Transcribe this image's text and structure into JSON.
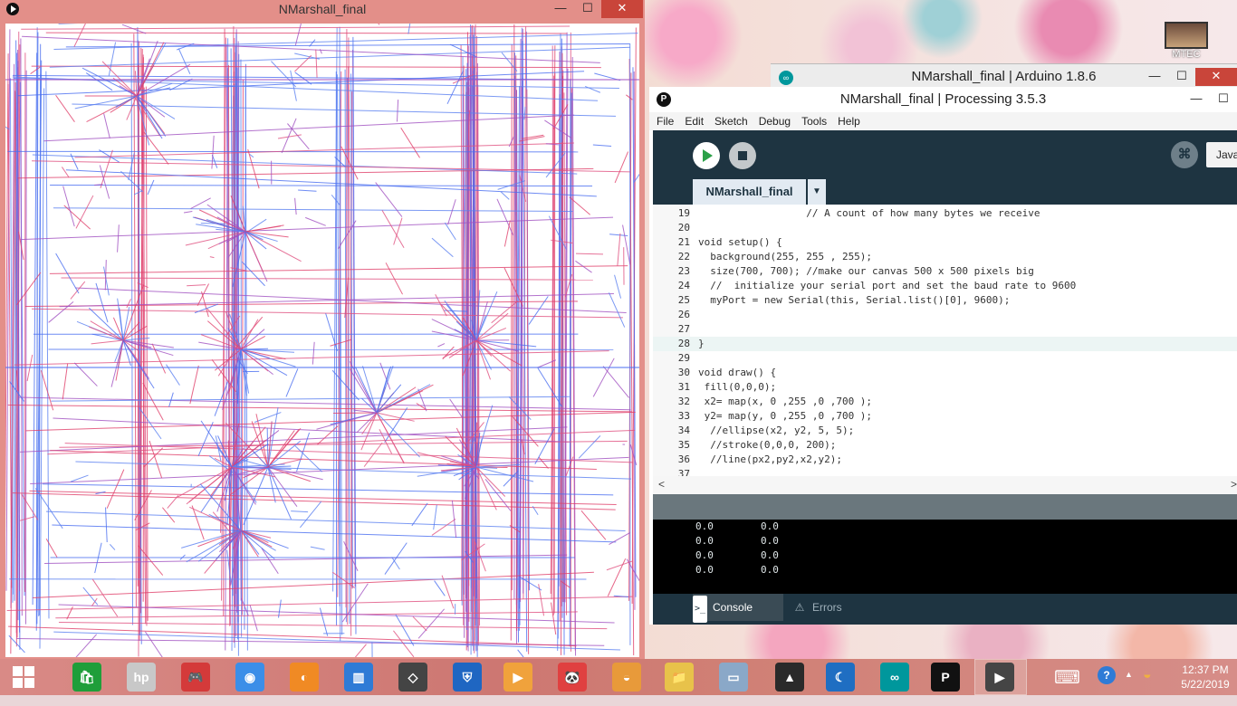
{
  "sketch_window": {
    "title": "NMarshall_final",
    "minimize": "—",
    "maximize": "☐",
    "close": "✕"
  },
  "arduino_window": {
    "title": "NMarshall_final | Arduino 1.8.6",
    "icon_text": "∞",
    "minimize": "—",
    "maximize": "☐",
    "close": "✕"
  },
  "desktop": {
    "shortcut_label": "MTEC"
  },
  "ide": {
    "title": "NMarshall_final | Processing 3.5.3",
    "icon_text": "P",
    "minimize": "—",
    "maximize": "☐",
    "menu": [
      "File",
      "Edit",
      "Sketch",
      "Debug",
      "Tools",
      "Help"
    ],
    "mode": "Java",
    "debugger_icon_text": "⌘",
    "tab_name": "NMarshall_final",
    "tab_menu": "▼",
    "code_lines": [
      {
        "n": "19",
        "text": "                  // A count of how many bytes we receive"
      },
      {
        "n": "20",
        "text": ""
      },
      {
        "n": "21",
        "text": "void setup() {"
      },
      {
        "n": "22",
        "text": "  background(255, 255 , 255);"
      },
      {
        "n": "23",
        "text": "  size(700, 700); //make our canvas 500 x 500 pixels big"
      },
      {
        "n": "24",
        "text": "  //  initialize your serial port and set the baud rate to 9600"
      },
      {
        "n": "25",
        "text": "  myPort = new Serial(this, Serial.list()[0], 9600);"
      },
      {
        "n": "26",
        "text": ""
      },
      {
        "n": "27",
        "text": ""
      },
      {
        "n": "28",
        "text": "}"
      },
      {
        "n": "29",
        "text": ""
      },
      {
        "n": "30",
        "text": "void draw() {"
      },
      {
        "n": "31",
        "text": " fill(0,0,0);"
      },
      {
        "n": "32",
        "text": " x2= map(x, 0 ,255 ,0 ,700 );"
      },
      {
        "n": "33",
        "text": " y2= map(y, 0 ,255 ,0 ,700 );"
      },
      {
        "n": "34",
        "text": "  //ellipse(x2, y2, 5, 5);"
      },
      {
        "n": "35",
        "text": "  //stroke(0,0,0, 200);"
      },
      {
        "n": "36",
        "text": "  //line(px2,py2,x2,y2);"
      },
      {
        "n": "37",
        "text": ""
      }
    ],
    "current_line": "28",
    "scroll_left": "<",
    "scroll_right": ">",
    "console_lines": [
      {
        "a": "0.0",
        "b": "0.0"
      },
      {
        "a": "0.0",
        "b": "0.0"
      },
      {
        "a": "0.0",
        "b": "0.0"
      },
      {
        "a": "0.0",
        "b": "0.0"
      }
    ],
    "console_tab": "Console",
    "errors_tab": "Errors",
    "console_icon": ">_",
    "errors_icon": "⚠"
  },
  "taskbar": {
    "start_icon": "start-windows-icon",
    "apps": [
      {
        "name": "store",
        "glyph": "🛍",
        "color": "#1f9e3a"
      },
      {
        "name": "hp",
        "glyph": "hp",
        "color": "#c8c8c8"
      },
      {
        "name": "games",
        "glyph": "🎮",
        "color": "#d43a3a"
      },
      {
        "name": "chrome",
        "glyph": "◉",
        "color": "#3b8ee8"
      },
      {
        "name": "blender",
        "glyph": "◐",
        "color": "#f08a24"
      },
      {
        "name": "stats",
        "glyph": "▥",
        "color": "#2f7bd6"
      },
      {
        "name": "unity",
        "glyph": "◇",
        "color": "#444444"
      },
      {
        "name": "defender",
        "glyph": "⛨",
        "color": "#1f66c2"
      },
      {
        "name": "media",
        "glyph": "▶",
        "color": "#f0a23c"
      },
      {
        "name": "panda",
        "glyph": "🐼",
        "color": "#e04040"
      },
      {
        "name": "landscape",
        "glyph": "◒",
        "color": "#e89a3a"
      },
      {
        "name": "explorer",
        "glyph": "📁",
        "color": "#e8c24a"
      },
      {
        "name": "monitor",
        "glyph": "▭",
        "color": "#8aa8c8"
      },
      {
        "name": "shark",
        "glyph": "▲",
        "color": "#2a2a2a"
      },
      {
        "name": "moon",
        "glyph": "☾",
        "color": "#1f6ec2"
      },
      {
        "name": "arduino",
        "glyph": "∞",
        "color": "#00979c"
      },
      {
        "name": "processing",
        "glyph": "P",
        "color": "#111111"
      },
      {
        "name": "sketch-run",
        "glyph": "▶",
        "color": "#111111"
      }
    ],
    "tray": {
      "keyboard": "⌨",
      "help": "?",
      "chevron": "▲",
      "network": "◒"
    },
    "time": "12:37 PM",
    "date": "5/22/2019"
  }
}
